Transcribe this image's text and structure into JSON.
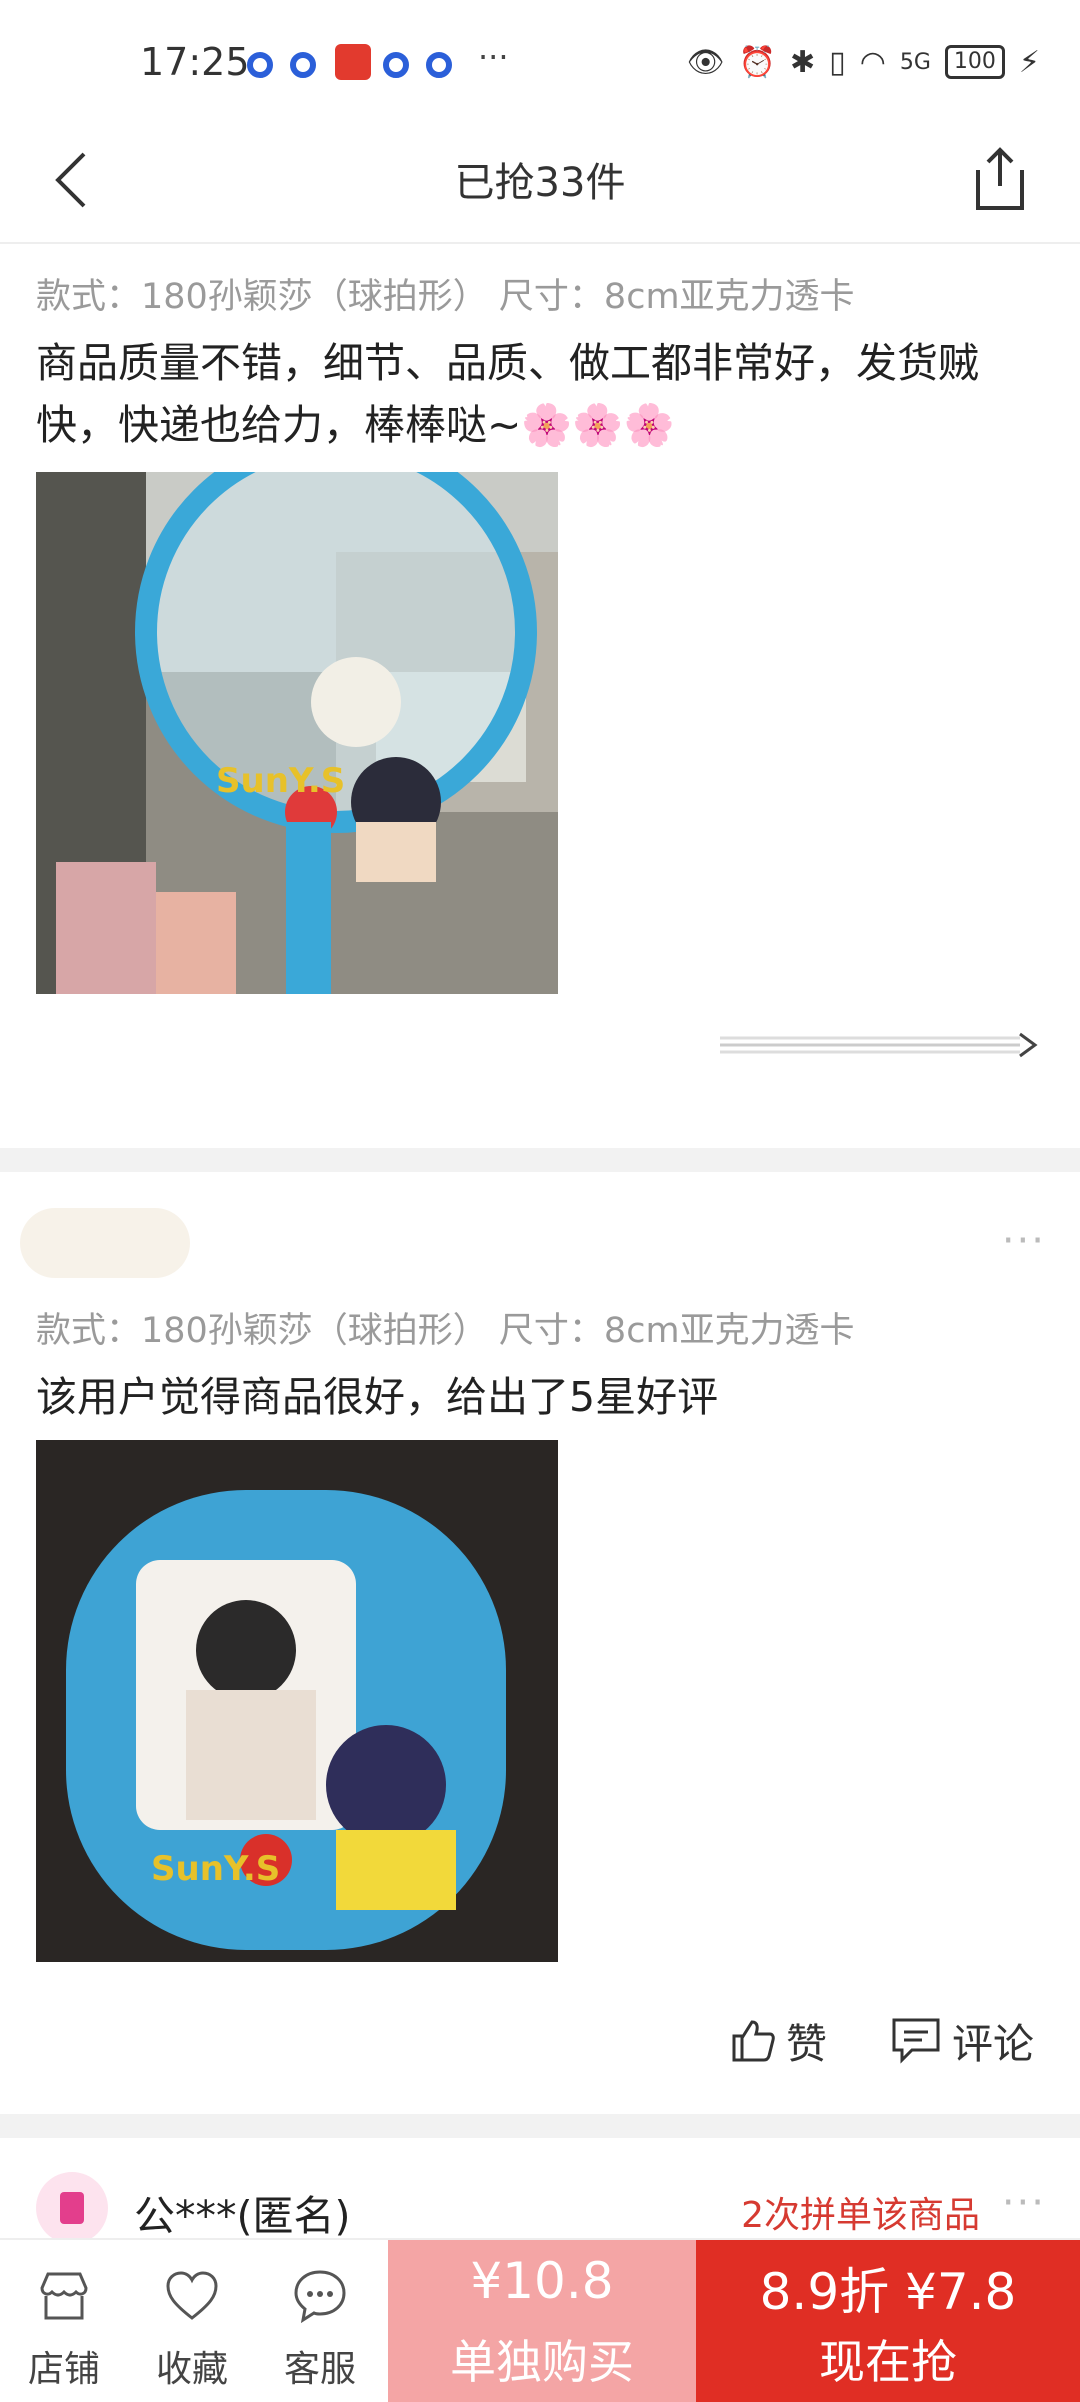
{
  "status_bar": {
    "time": "17:25",
    "dots": "···",
    "battery": "100",
    "network": "5G"
  },
  "nav": {
    "title": "已抢33件"
  },
  "reviews": [
    {
      "spec": "款式：180孙颖莎（球拍形）  尺寸：8cm亚克力透卡",
      "text": "商品质量不错，细节、品质、做工都非常好，发货贼快，快递也给力，棒棒哒~🌸🌸🌸",
      "photo_text": "SunY.S"
    },
    {
      "spec": "款式：180孙颖莎（球拍形）  尺寸：8cm亚克力透卡",
      "text": "该用户觉得商品很好，给出了5星好评",
      "photo_text": "SunY.S",
      "like_label": "赞",
      "comment_label": "评论"
    }
  ],
  "next_review": {
    "user": "公***(匿名)",
    "badge": "2次拼单该商品"
  },
  "bottom": {
    "store": "店铺",
    "favorite": "收藏",
    "service": "客服",
    "single_price": "¥10.8",
    "single_label": "单独购买",
    "group_price": "8.9折 ¥7.8",
    "group_label": "现在抢"
  },
  "colors": {
    "accent": "#e02e24",
    "accent_light": "#f4a5a5",
    "muted": "#9a9a9a"
  },
  "icons": [
    "back-icon",
    "share-icon",
    "like-icon",
    "comment-icon",
    "store-icon",
    "heart-icon",
    "chat-icon"
  ]
}
